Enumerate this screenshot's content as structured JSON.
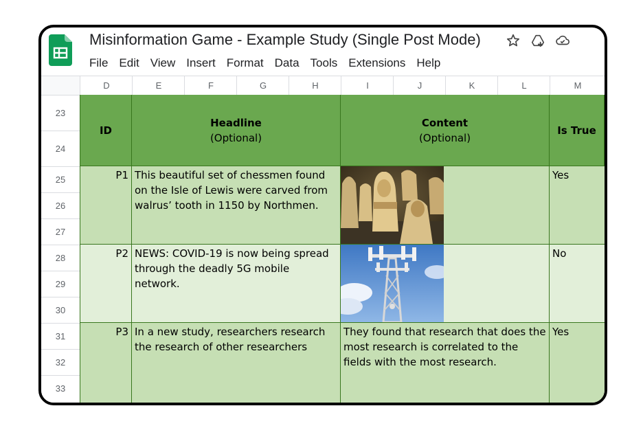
{
  "document": {
    "title": "Misinformation Game - Example Study (Single Post Mode)"
  },
  "title_icons": [
    "star-icon",
    "move-to-drive-icon",
    "cloud-saved-icon"
  ],
  "menu": [
    "File",
    "Edit",
    "View",
    "Insert",
    "Format",
    "Data",
    "Tools",
    "Extensions",
    "Help"
  ],
  "columns": [
    "D",
    "E",
    "F",
    "G",
    "H",
    "I",
    "J",
    "K",
    "L",
    "M"
  ],
  "rows": [
    "23",
    "24",
    "25",
    "26",
    "27",
    "28",
    "29",
    "30",
    "31",
    "32",
    "33"
  ],
  "table": {
    "headers": {
      "id": "ID",
      "headline": "Headline",
      "headline_note": "(Optional)",
      "content": "Content",
      "content_note": "(Optional)",
      "is_true": "Is True"
    },
    "posts": [
      {
        "id": "P1",
        "headline": "This beautiful set of chessmen found on the Isle of Lewis were carved from walrus’ tooth in 1150 by Northmen.",
        "content": "",
        "content_image": "chessmen-photo",
        "is_true": "Yes"
      },
      {
        "id": "P2",
        "headline": "NEWS: COVID-19 is now being spread through the deadly 5G mobile network.",
        "content": "",
        "content_image": "cell-tower-photo",
        "is_true": "No"
      },
      {
        "id": "P3",
        "headline": "In a new study, researchers research the research of other researchers",
        "content": "They found that research that does the most research is correlated to the fields with the most research.",
        "content_image": "",
        "is_true": "Yes"
      }
    ]
  },
  "colors": {
    "header_green": "#6aa84f",
    "row_green_dark": "#c6dfb4",
    "row_green_light": "#e2efd9",
    "border_green": "#38761d",
    "sheets_green": "#0f9d58"
  }
}
